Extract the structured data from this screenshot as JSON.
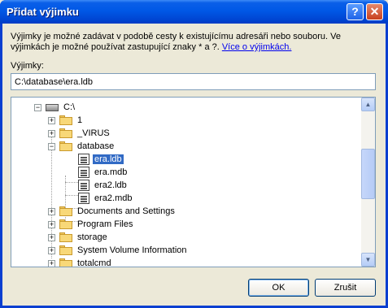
{
  "dialog": {
    "title": "Přidat výjimku",
    "help_glyph": "?",
    "close_glyph": "✕",
    "description": "Výjimky je možné zadávat v podobě cesty k existujícímu adresáři nebo souboru. Ve výjimkách je možné používat zastupující znaky * a ?. ",
    "description_link": "Více o výjimkách.",
    "exceptions_label": "Výjimky:",
    "path_value": "C:\\database\\era.ldb"
  },
  "tree": {
    "root": "C:\\",
    "items": [
      {
        "label": "1"
      },
      {
        "label": "_VIRUS"
      },
      {
        "label": "database"
      },
      {
        "label": "era.ldb"
      },
      {
        "label": "era.mdb"
      },
      {
        "label": "era2.ldb"
      },
      {
        "label": "era2.mdb"
      },
      {
        "label": "Documents and Settings"
      },
      {
        "label": "Program Files"
      },
      {
        "label": "storage"
      },
      {
        "label": "System Volume Information"
      },
      {
        "label": "totalcmd"
      }
    ],
    "expander_plus": "+",
    "expander_minus": "−"
  },
  "scrollbar": {
    "up": "▲",
    "down": "▼"
  },
  "buttons": {
    "ok": "OK",
    "cancel": "Zrušit"
  },
  "colors": {
    "selection": "#316ac5",
    "titlebar": "#0058e6"
  }
}
